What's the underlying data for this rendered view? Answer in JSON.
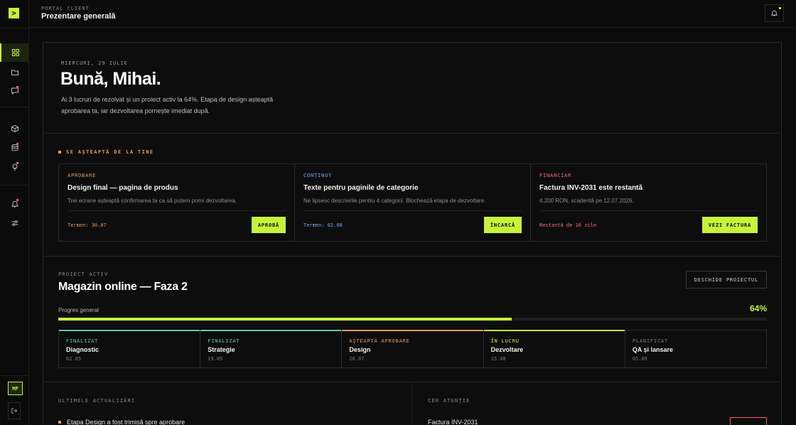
{
  "header": {
    "crumb": "PORTAL CLIENT",
    "title": "Prezentare generală"
  },
  "sidebar": {
    "logo": ">",
    "items": [
      {
        "icon": "grid-icon",
        "active": true,
        "dot": false
      },
      {
        "icon": "folder-icon",
        "active": false,
        "dot": false
      },
      {
        "icon": "chat-icon",
        "active": false,
        "dot": true
      },
      {
        "icon": "cube-icon",
        "active": false,
        "dot": false
      },
      {
        "icon": "database-icon",
        "active": false,
        "dot": true
      },
      {
        "icon": "bulb-icon",
        "active": false,
        "dot": true
      },
      {
        "icon": "bell-icon",
        "active": false,
        "dot": true
      },
      {
        "icon": "sliders-icon",
        "active": false,
        "dot": false
      }
    ],
    "avatar": "MP"
  },
  "hero": {
    "date": "MIERCURI, 29 IULIE",
    "greeting": "Bună, Mihai.",
    "text": "Ai 3 lucruri de rezolvat și un proiect activ la 64%. Etapa de design așteaptă aprobarea ta, iar dezvoltarea pornește imediat după."
  },
  "tasks": {
    "label": "SE AȘTEAPTĂ DE LA TINE",
    "cards": [
      {
        "tag": "APROBARE",
        "tag_color": "#e39a5a",
        "title": "Design final — pagina de produs",
        "desc": "Trei ecrane așteaptă confirmarea ta ca să putem porni dezvoltarea.",
        "meta": "Termen: 30.07",
        "meta_color": "#e39a5a",
        "button": "APROBĂ"
      },
      {
        "tag": "CONȚINUT",
        "tag_color": "#7aa8ff",
        "title": "Texte pentru paginile de categorie",
        "desc": "Ne lipsesc descrierile pentru 4 categorii. Blochează etapa de dezvoltare.",
        "meta": "Termen: 02.08",
        "meta_color": "#7aa8ff",
        "button": "ÎNCARCĂ"
      },
      {
        "tag": "FINANCIAR",
        "tag_color": "#ff6b7a",
        "title": "Factura INV-2031 este restantă",
        "desc": "4.200 RON, scadentă pe 12.07.2026.",
        "meta": "Restantă de 16 zile",
        "meta_color": "#ff6b7a",
        "button": "VEZI FACTURA"
      }
    ]
  },
  "project": {
    "label": "PROIECT ACTIV",
    "title": "Magazin online — Faza 2",
    "open_button": "DESCHIDE PROIECTUL",
    "progress_label": "Progres general",
    "progress_text": "64%",
    "progress": 0.64,
    "phases": [
      {
        "status": "FINALIZAT",
        "name": "Diagnostic",
        "date": "02.05",
        "color": "#5fc9b0"
      },
      {
        "status": "FINALIZAT",
        "name": "Strategie",
        "date": "19.05",
        "color": "#5fc9b0"
      },
      {
        "status": "AȘTEAPTĂ APROBARE",
        "name": "Design",
        "date": "26.07",
        "color": "#e39a5a"
      },
      {
        "status": "ÎN LUCRU",
        "name": "Dezvoltare",
        "date": "15.08",
        "color": "#c6f33a"
      },
      {
        "status": "PLANIFICAT",
        "name": "QA și lansare",
        "date": "05.09",
        "color": "#7a7a7a"
      }
    ]
  },
  "updates": {
    "label": "ULTIMELE ACTUALIZĂRI",
    "first": "Etapa Design a fost trimisă spre aprobare"
  },
  "attention": {
    "label": "CER ATENȚIE",
    "first": "Factura INV-2031"
  }
}
